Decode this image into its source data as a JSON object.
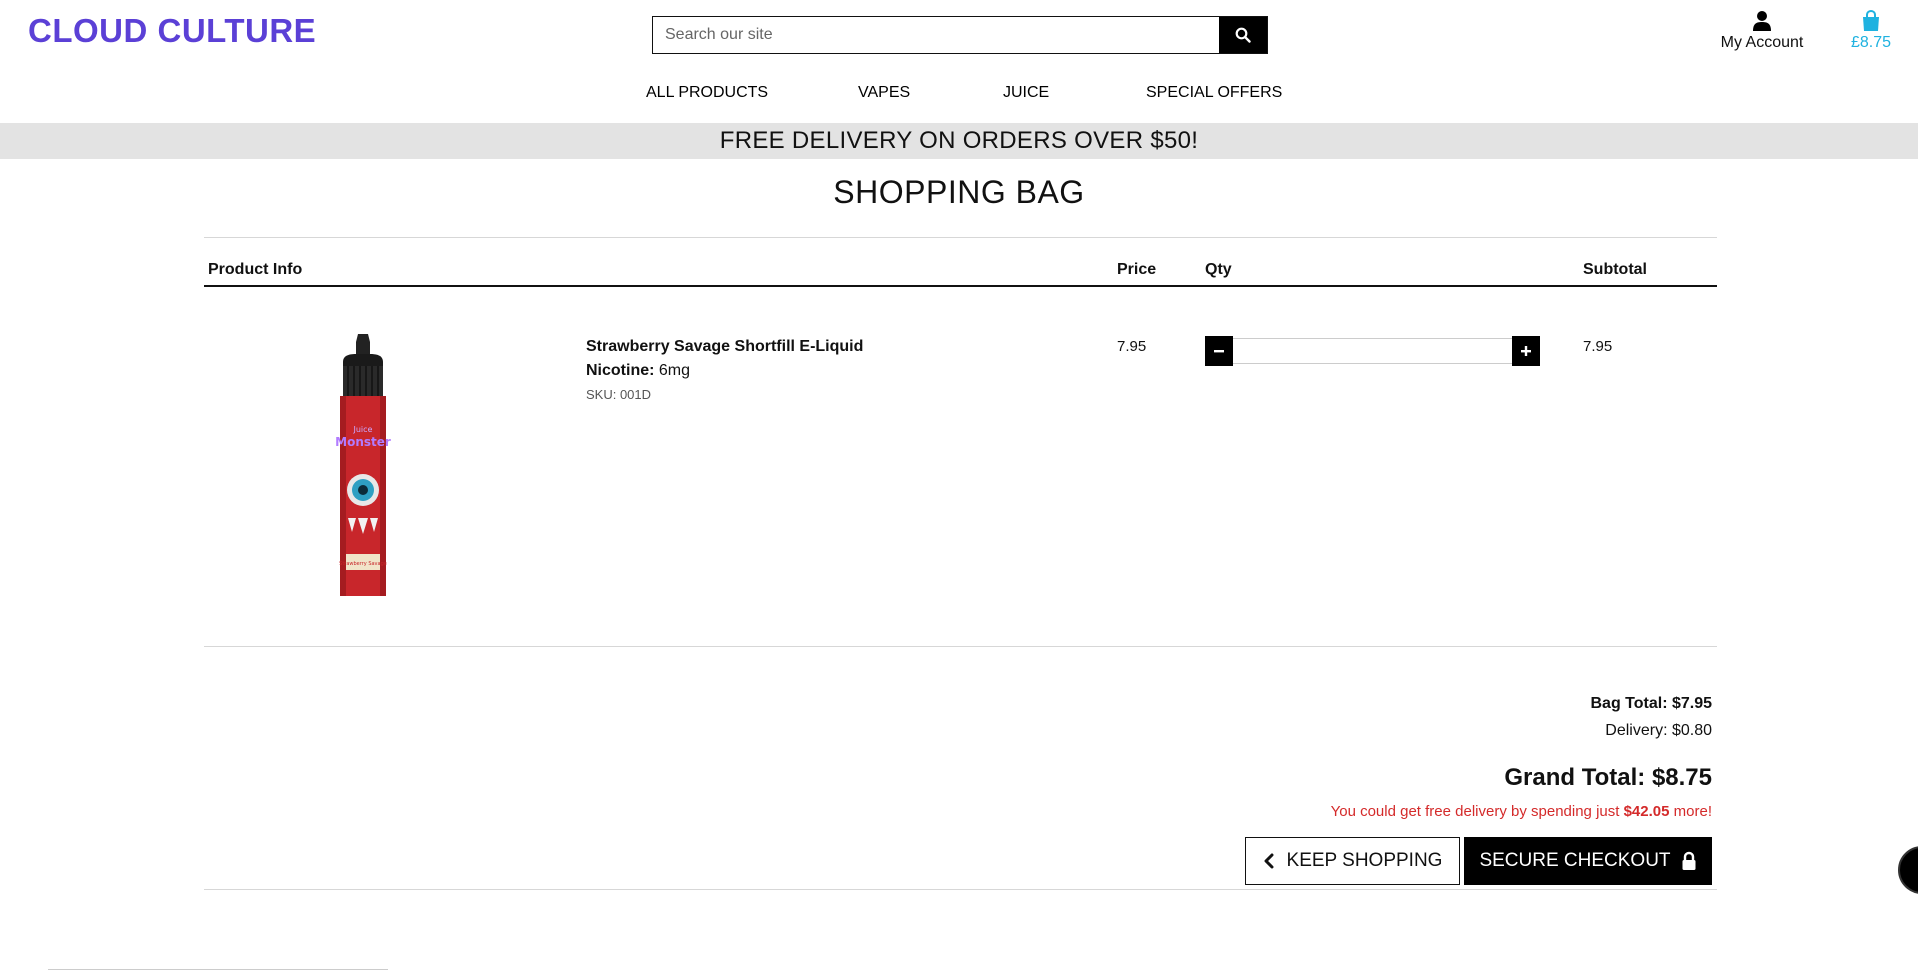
{
  "header": {
    "logo": "CLOUD CULTURE",
    "search_placeholder": "Search our site",
    "account_label": "My Account",
    "bag_total": "£8.75"
  },
  "nav": [
    "ALL PRODUCTS",
    "VAPES",
    "JUICE",
    "SPECIAL OFFERS"
  ],
  "banner": "FREE DELIVERY ON ORDERS OVER $50!",
  "page_title": "SHOPPING BAG",
  "table": {
    "headers": {
      "product": "Product Info",
      "price": "Price",
      "qty": "Qty",
      "subtotal": "Subtotal"
    },
    "item": {
      "name": "Strawberry Savage Shortfill E-Liquid",
      "nicotine_label": "Nicotine:",
      "nicotine_value": "6mg",
      "sku": "SKU: 001D",
      "price": "7.95",
      "qty": "",
      "subtotal": "7.95",
      "image_text_1": "Juice",
      "image_text_2": "Monster",
      "image_text_3": "Strawberry Savage"
    }
  },
  "totals": {
    "bag_total": "Bag Total: $7.95",
    "delivery": "Delivery: $0.80",
    "grand_total": "Grand Total: $8.75",
    "free_prefix": "You could get free delivery by spending just",
    "free_amount": "$42.05",
    "free_suffix": "more!"
  },
  "buttons": {
    "keep_shopping": "KEEP SHOPPING",
    "checkout": "SECURE CHECKOUT"
  },
  "colors": {
    "brand": "#5b40d6",
    "bag_accent": "#1fb2e0",
    "warning": "#d42a2a"
  },
  "icons": [
    "search-icon",
    "user-icon",
    "shopping-bag-icon",
    "minus-icon",
    "plus-icon",
    "chevron-left-icon",
    "lock-icon"
  ]
}
